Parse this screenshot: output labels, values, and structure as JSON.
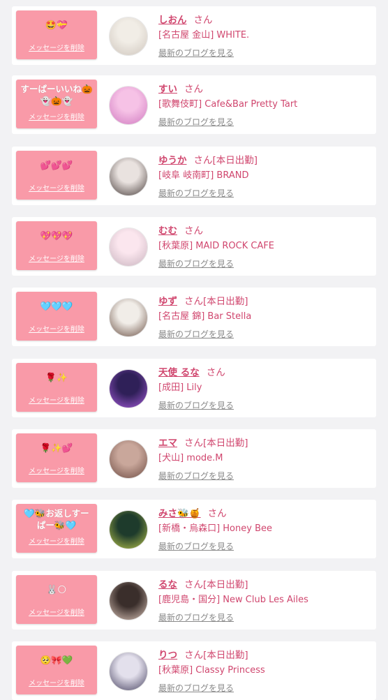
{
  "delete_label": "メッセージを削除",
  "blog_label": "最新のブログを見る",
  "san_label": "さん",
  "cards": [
    {
      "message": "🤩💝",
      "name": "しおん",
      "work_today": "",
      "shop": "[名古屋 金山] WHITE.",
      "avatar_colors": [
        "#f1ede6",
        "#cfc6bd"
      ]
    },
    {
      "message": "すーぱーいいね🎃\n👻🎃👻",
      "name": "すい",
      "work_today": "",
      "shop": "[歌舞伎町] Cafe&Bar Pretty Tart",
      "avatar_colors": [
        "#f6c2e6",
        "#d07ac0"
      ]
    },
    {
      "message": "💕💕💕",
      "name": "ゆうか",
      "work_today": "[本日出勤]",
      "shop": "[岐阜 岐南町] BRAND",
      "avatar_colors": [
        "#e9e2df",
        "#4a3f3d"
      ]
    },
    {
      "message": "💖💖💖",
      "name": "むむ",
      "work_today": "",
      "shop": "[秋葉原] MAID ROCK CAFE",
      "avatar_colors": [
        "#fbe6ee",
        "#c9b4bf"
      ]
    },
    {
      "message": "🩵🩵🩵",
      "name": "ゆず",
      "work_today": "[本日出勤]",
      "shop": "[名古屋 錦] Bar Stella",
      "avatar_colors": [
        "#f1ede8",
        "#6d5347"
      ]
    },
    {
      "message": "🌹✨",
      "name": "天使 るな",
      "work_today": "",
      "shop": "[成田] Lily",
      "avatar_colors": [
        "#2f2058",
        "#a35ad6"
      ]
    },
    {
      "message": "🌹✨💕",
      "name": "エマ",
      "work_today": "[本日出勤]",
      "shop": "[犬山] mode.M",
      "avatar_colors": [
        "#c9a79b",
        "#6f4d44"
      ]
    },
    {
      "message": "🩵🐝お返しすー\nぱー🐝🩵",
      "name": "みさ🐝🍯",
      "work_today": "",
      "shop": "[新橋・烏森口] Honey Bee",
      "avatar_colors": [
        "#1e3b2c",
        "#b7c34b"
      ]
    },
    {
      "message": "🐰🌕",
      "name": "るな",
      "work_today": "[本日出勤]",
      "shop": "[鹿児島・国分] New Club Les Ailes",
      "avatar_colors": [
        "#3a2e2b",
        "#d8c2b6"
      ]
    },
    {
      "message": "🥺🎀💚",
      "name": "りつ",
      "work_today": "[本日出勤]",
      "shop": "[秋葉原] Classy Princess",
      "avatar_colors": [
        "#e3e0ec",
        "#4a4563"
      ]
    }
  ]
}
